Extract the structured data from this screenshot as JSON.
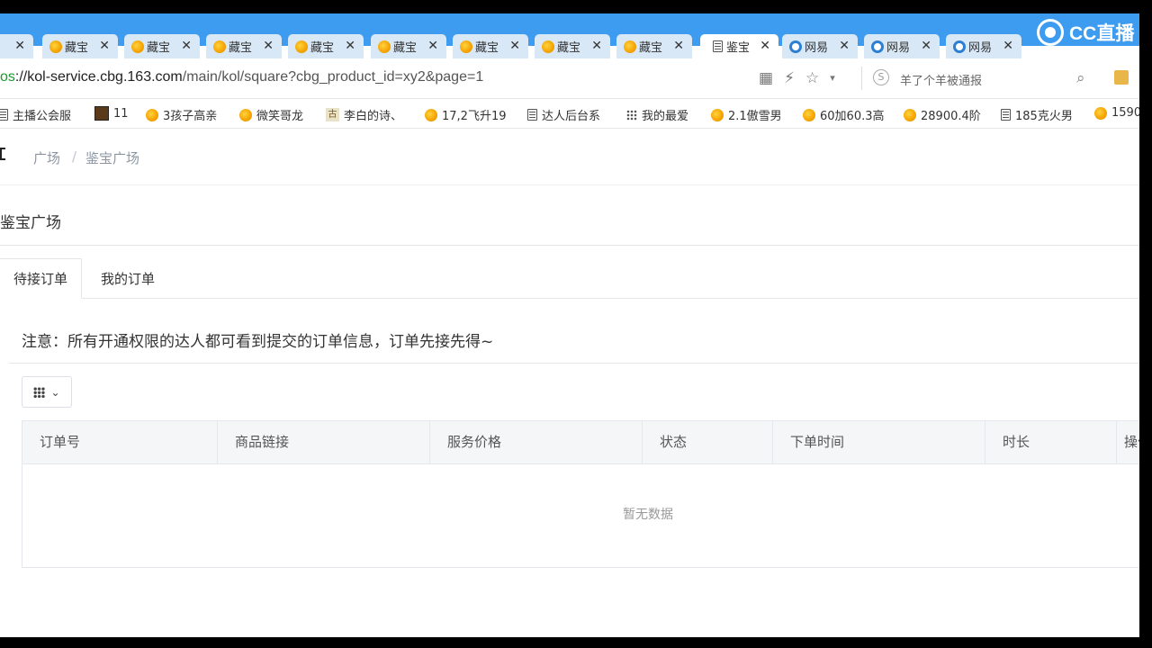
{
  "browser": {
    "tabs": [
      {
        "label": "",
        "icon": "yellow-chick-icon",
        "active": false
      },
      {
        "label": "藏宝",
        "icon": "yellow-chick-icon",
        "active": false
      },
      {
        "label": "藏宝",
        "icon": "yellow-chick-icon",
        "active": false
      },
      {
        "label": "藏宝",
        "icon": "yellow-chick-icon",
        "active": false
      },
      {
        "label": "藏宝",
        "icon": "yellow-chick-icon",
        "active": false
      },
      {
        "label": "藏宝",
        "icon": "yellow-chick-icon",
        "active": false
      },
      {
        "label": "藏宝",
        "icon": "yellow-chick-icon",
        "active": false
      },
      {
        "label": "藏宝",
        "icon": "yellow-chick-icon",
        "active": false
      },
      {
        "label": "藏宝",
        "icon": "yellow-chick-icon",
        "active": false
      },
      {
        "label": "鉴宝",
        "icon": "document-icon",
        "active": true
      },
      {
        "label": "网易",
        "icon": "netease-icon",
        "active": false
      },
      {
        "label": "网易",
        "icon": "netease-icon",
        "active": false
      },
      {
        "label": "网易",
        "icon": "netease-icon",
        "active": false
      }
    ],
    "close_glyph": "✕",
    "overlay_logo": "CC直播",
    "url": {
      "proto": "os",
      "host": "://kol-service.cbg.163.com",
      "path": "/main/kol/square?cbg_product_id=xy2&page=1"
    },
    "search_placeholder": "羊了个羊被通报",
    "search_engine_glyph": "S",
    "bookmarks": [
      {
        "label": "主播公会服",
        "icon": "document-icon"
      },
      {
        "label": "11",
        "icon": "photo-icon"
      },
      {
        "label": "3孩子高亲",
        "icon": "yellow-chick-icon"
      },
      {
        "label": "微笑哥龙",
        "icon": "yellow-chick-icon"
      },
      {
        "label": "李白的诗、",
        "icon": "poem-icon"
      },
      {
        "label": "17,2飞升19",
        "icon": "yellow-chick-icon"
      },
      {
        "label": "达人后台系",
        "icon": "document-icon"
      },
      {
        "label": "我的最爱",
        "icon": "apps-grid-icon"
      },
      {
        "label": "2.1傲雪男",
        "icon": "yellow-chick-icon"
      },
      {
        "label": "60加60.3高",
        "icon": "yellow-chick-icon"
      },
      {
        "label": "28900.4阶",
        "icon": "yellow-chick-icon"
      },
      {
        "label": "185克火男",
        "icon": "document-icon"
      },
      {
        "label": "1590",
        "icon": "yellow-chick-icon"
      }
    ],
    "poem_icon_char": "古"
  },
  "page": {
    "breadcrumb": {
      "root": "广场",
      "separator": "/",
      "current": "鉴宝广场"
    },
    "title": "鉴宝广场",
    "tabs": {
      "pending": "待接订单",
      "mine": "我的订单"
    },
    "notice": "注意：所有开通权限的达人都可看到提交的订单信息，订单先接先得~",
    "table": {
      "columns": [
        "订单号",
        "商品链接",
        "服务价格",
        "状态",
        "下单时间",
        "时长",
        "操作"
      ],
      "rows": [],
      "empty_text": "暂无数据"
    }
  }
}
